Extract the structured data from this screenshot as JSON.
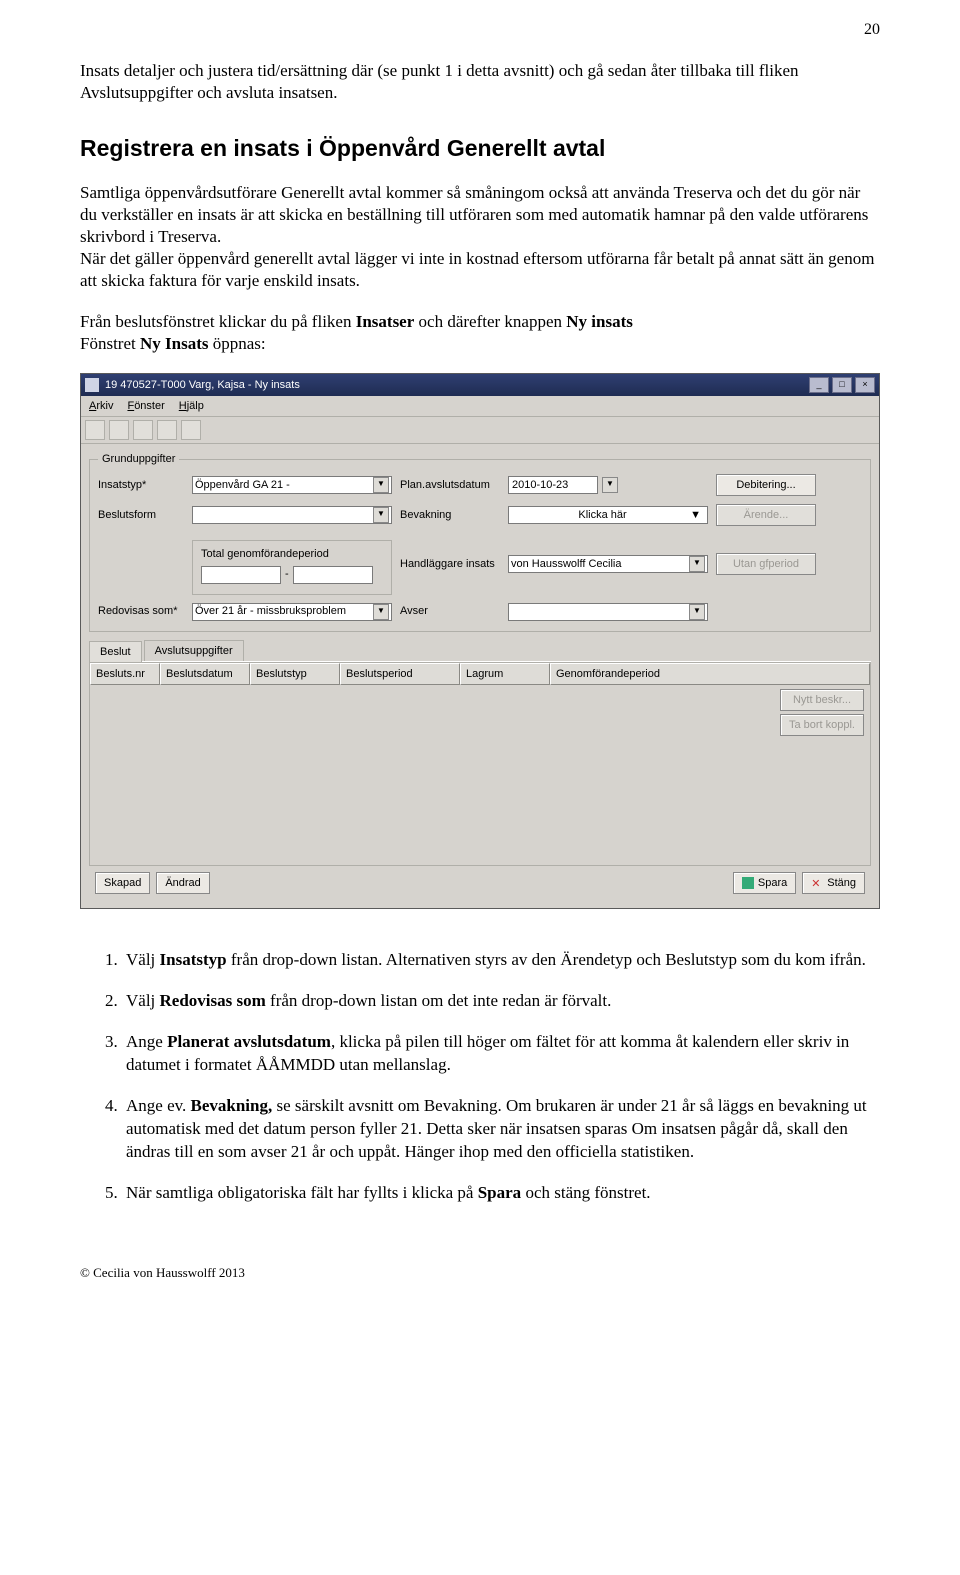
{
  "page_number": "20",
  "intro": "Insats detaljer och justera tid/ersättning där (se punkt 1 i detta avsnitt) och gå sedan åter tillbaka till fliken Avslutsuppgifter och avsluta insatsen.",
  "heading": "Registrera en insats i Öppenvård Generellt avtal",
  "para_a": "Samtliga öppenvårdsutförare Generellt avtal kommer så småningom också att använda Treserva och det du gör när du verkställer en insats är att skicka en beställning till utföraren som med automatik hamnar på den valde utförarens skrivbord i Treserva.",
  "para_b": "När det gäller öppenvård generellt avtal lägger vi inte in kostnad eftersom utförarna får betalt på annat sätt än genom att skicka faktura för varje enskild insats.",
  "para_c_1": "Från beslutsfönstret klickar du på fliken ",
  "para_c_b1": "Insatser",
  "para_c_2": " och därefter knappen ",
  "para_c_b2": "Ny insats",
  "para_c_3": "Fönstret ",
  "para_c_b3": "Ny Insats",
  "para_c_4": " öppnas:",
  "win": {
    "title": "19 470527-T000  Varg, Kajsa  -  Ny insats",
    "menu": {
      "m1_u": "A",
      "m1": "rkiv",
      "m2_u": "F",
      "m2": "önster",
      "m3_u": "H",
      "m3": "jälp"
    },
    "group": "Grunduppgifter",
    "lbl_insatstyp": "Insatstyp*",
    "val_insatstyp": "Öppenvård GA 21 -",
    "lbl_avslut": "Plan.avslutsdatum",
    "val_avslut": "2010-10-23",
    "btn_deb": "Debitering...",
    "lbl_beslut": "Beslutsform",
    "lbl_bev": "Bevakning",
    "val_bev": "Klicka här",
    "btn_arende": "Ärende...",
    "lbl_genomf": "Total genomförandeperiod",
    "lbl_handl": "Handläggare insats",
    "val_handl": "von Hausswolff Cecilia",
    "btn_utan": "Utan gfperiod",
    "lbl_redo": "Redovisas som*",
    "val_redo": "Över 21 år - missbruksproblem",
    "lbl_avser": "Avser",
    "tab1": "Beslut",
    "tab2": "Avslutsuppgifter",
    "th": {
      "c1": "Besluts.nr",
      "c2": "Beslutsdatum",
      "c3": "Beslutstyp",
      "c4": "Beslutsperiod",
      "c5": "Lagrum",
      "c6": "Genomförandeperiod"
    },
    "btn_nytt": "Nytt beskr...",
    "btn_tabort": "Ta bort koppl.",
    "btn_skapad": "Skapad",
    "btn_andrad": "Ändrad",
    "btn_spara": "Spara",
    "btn_stang": "Stäng"
  },
  "steps": {
    "s1a": "Välj ",
    "s1b": "Insatstyp",
    "s1c": " från drop-down listan. Alternativen styrs av den Ärendetyp och Beslutstyp som du kom ifrån.",
    "s2a": "Välj ",
    "s2b": "Redovisas som",
    "s2c": " från drop-down listan om det inte redan är förvalt.",
    "s3a": "Ange ",
    "s3b": "Planerat avslutsdatum",
    "s3c": ", klicka på pilen till höger om fältet för att komma åt kalendern eller skriv in datumet i formatet ÅÅMMDD utan mellanslag.",
    "s4a": "Ange ev. ",
    "s4b": "Bevakning,",
    "s4c": " se särskilt avsnitt om Bevakning. Om brukaren är under 21 år så läggs en bevakning ut automatisk med det datum person fyller 21. Detta sker när insatsen sparas Om insatsen pågår då, skall den ändras till en som avser 21 år och uppåt. Hänger ihop med den officiella statistiken.",
    "s5a": "När samtliga obligatoriska fält har fyllts i klicka på ",
    "s5b": "Spara",
    "s5c": " och stäng fönstret."
  },
  "footer": "© Cecilia von Hausswolff 2013"
}
